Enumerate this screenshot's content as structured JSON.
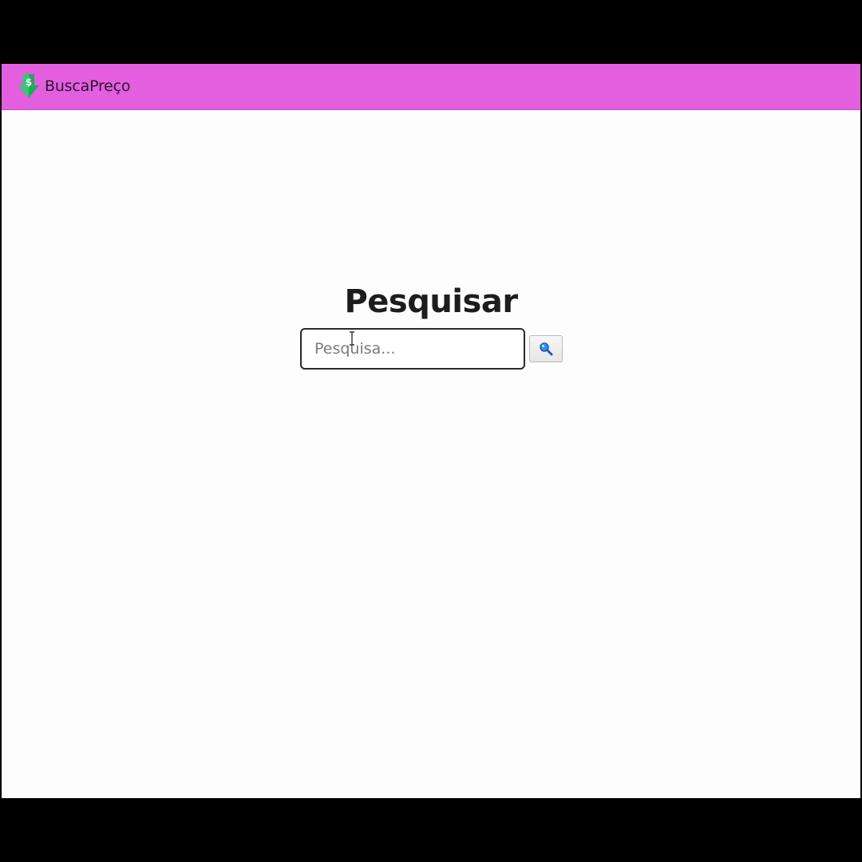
{
  "app": {
    "brand_name": "BuscaPreço",
    "brand_logo_icon": "download-dollar-icon"
  },
  "colors": {
    "navbar_background": "#e35fe0",
    "page_background": "#fdfdfd",
    "logo_green": "#2ecc71",
    "search_icon_blue": "#1a73e8"
  },
  "search": {
    "title": "Pesquisar",
    "placeholder": "Pesquisa...",
    "value": "",
    "button_icon": "search-icon"
  }
}
